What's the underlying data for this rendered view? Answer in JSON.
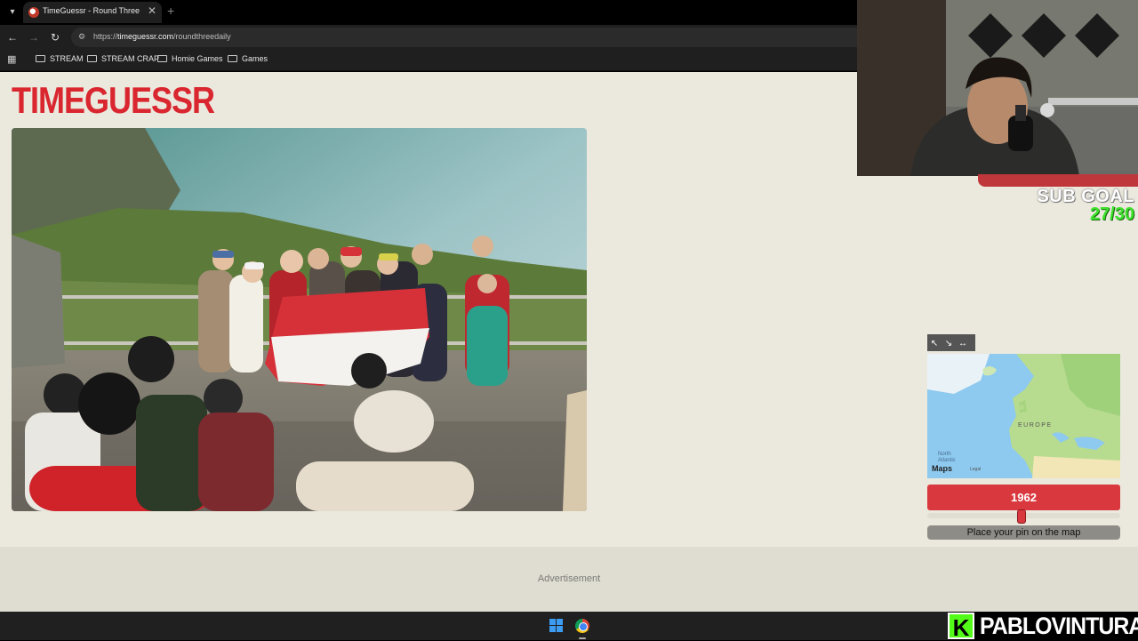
{
  "browser": {
    "tab_title": "TimeGuessr - Round Three",
    "tab_close": "✕",
    "new_tab": "+",
    "url_prefix": "https://",
    "url_domain": "timeguessr.com",
    "url_path": "/roundthreedaily",
    "bookmarks": [
      "STREAM",
      "STREAM CRAP",
      "Homie Games",
      "Games"
    ]
  },
  "game": {
    "logo": "TIMEGUESSR",
    "year": "1962",
    "year_slider_fraction": 0.49,
    "pin_prompt": "Place your pin on the map",
    "map": {
      "region_label": "EUROPE",
      "ocean_label_line1": "North",
      "ocean_label_line2": "Atlantic",
      "brand": "Maps",
      "legal": "Legal",
      "tools": [
        "↖",
        "↘",
        "↔"
      ]
    },
    "advertisement": "Advertisement"
  },
  "overlay": {
    "sub_goal_label": "SUB GOAL",
    "sub_goal_count": "27/30",
    "kick_letter": "K",
    "streamer_name": "PABLOVINTURA"
  },
  "colors": {
    "accent": "#d9393e",
    "page_bg": "#ebe9de",
    "kick_green": "#53fc18",
    "goal_green": "#3de12b"
  }
}
